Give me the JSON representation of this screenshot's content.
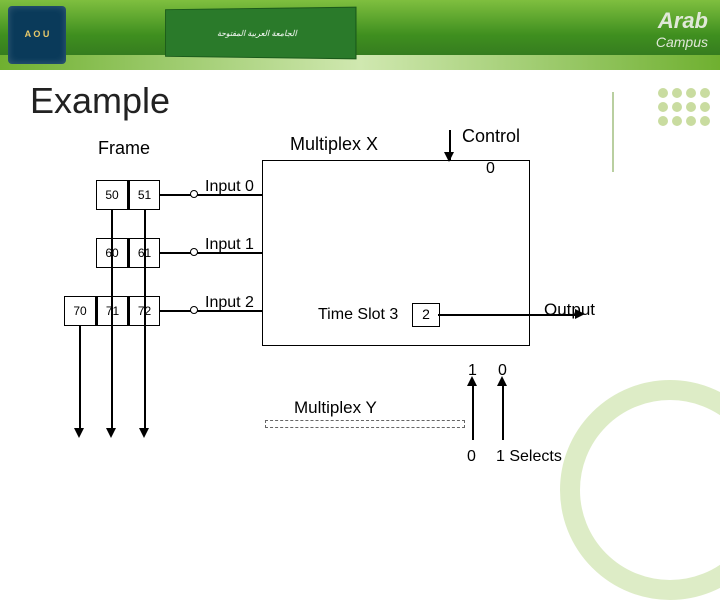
{
  "header": {
    "logo_text": "A O U",
    "flag_text": "الجامعة العربية المفتوحة",
    "brand_line1": "Arab",
    "brand_line2": "Campus"
  },
  "title": "Example",
  "labels": {
    "frame": "Frame",
    "multiplex_x": "Multiplex X",
    "control": "Control",
    "input0": "Input 0",
    "input1": "Input 1",
    "input2": "Input 2",
    "time_slot": "Time Slot 3",
    "output": "Output",
    "multiplex_y": "Multiplex Y",
    "selects": "1 Selects"
  },
  "frames": {
    "row0": [
      "50",
      "51"
    ],
    "row1": [
      "60",
      "61"
    ],
    "row2": [
      "70",
      "71",
      "72"
    ]
  },
  "values": {
    "control_top": "0",
    "slot_value": "2",
    "out_bits": [
      "1",
      "0"
    ],
    "sel0": "0"
  }
}
